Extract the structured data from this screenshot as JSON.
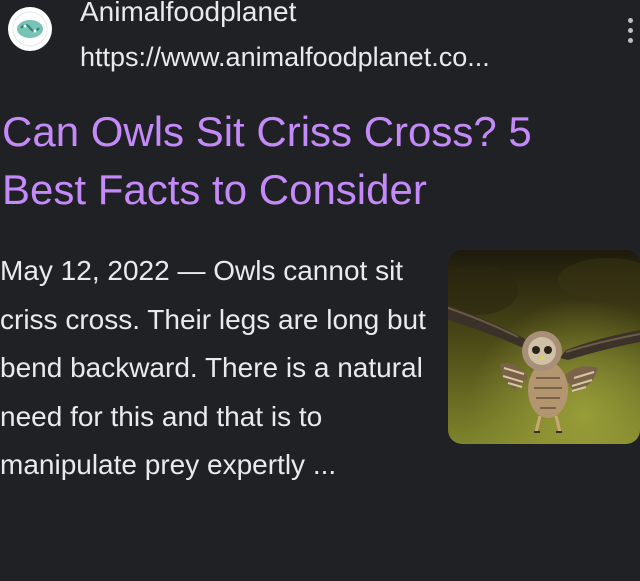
{
  "result": {
    "site_name": "Animalfoodplanet",
    "url": "https://www.animalfoodplanet.co...",
    "title": "Can Owls Sit Criss Cross? 5 Best Facts to Consider",
    "date": "May 12, 2022",
    "separator": " — ",
    "snippet": "Owls cannot sit criss cross. Their legs are long but bend backward. There is a natural need for this and that is to manipulate prey expertly ...",
    "favicon_icon": "animalfoodplanet-logo-icon",
    "thumbnail_icon": "flying-owl-photo",
    "more_icon": "three-dot-vertical-icon"
  },
  "colors": {
    "background": "#202124",
    "title_link": "#c58af9",
    "text": "#e8eaed",
    "favicon_bg": "#ffffff",
    "favicon_accent": "#5fb8a8"
  }
}
